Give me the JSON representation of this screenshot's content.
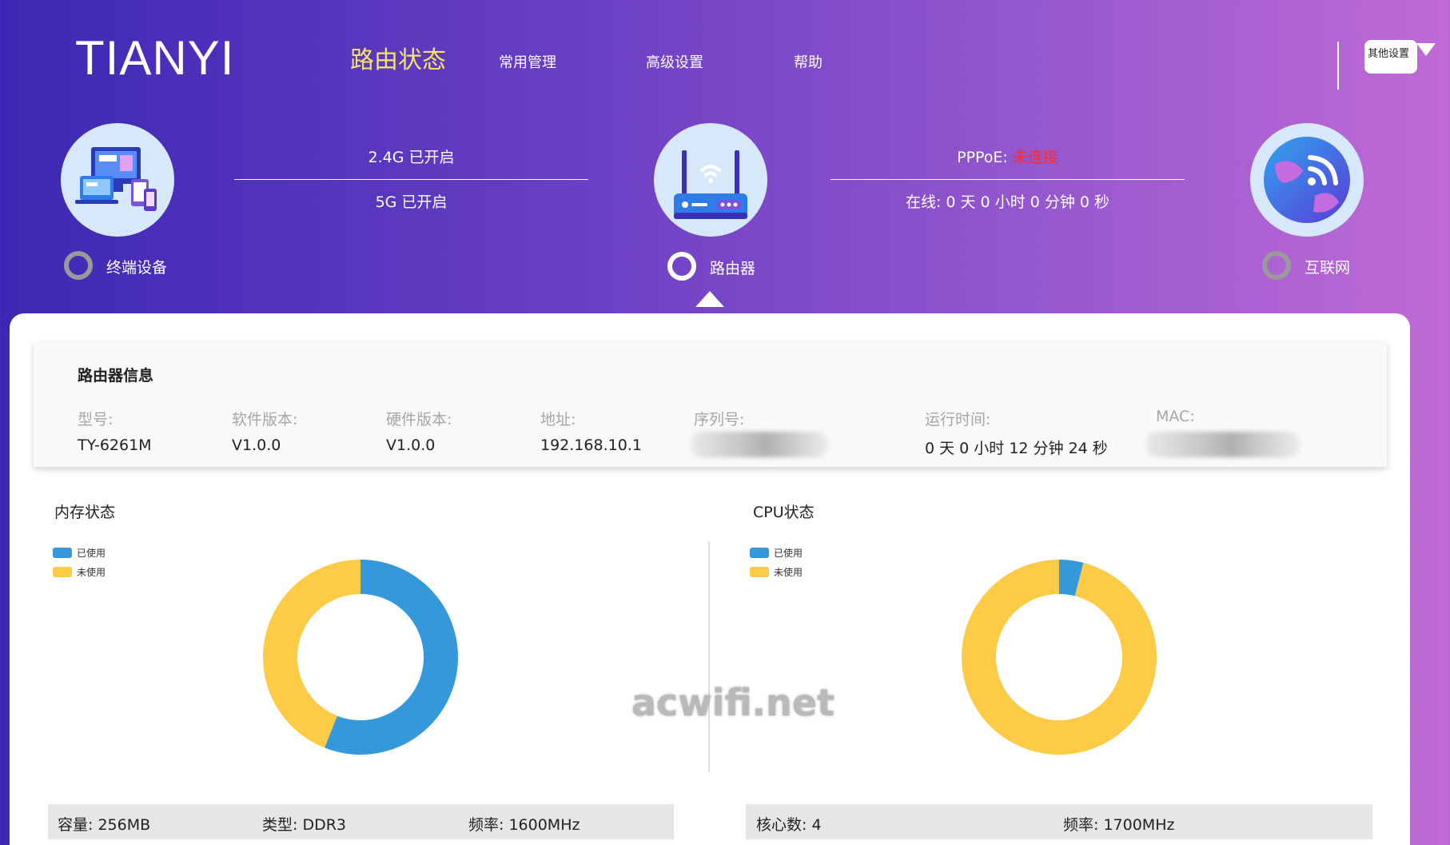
{
  "header": {
    "logo": "TIANYI",
    "nav": [
      {
        "label": "路由状态",
        "active": true
      },
      {
        "label": "常用管理",
        "active": false
      },
      {
        "label": "高级设置",
        "active": false
      },
      {
        "label": "帮助",
        "active": false
      }
    ],
    "other_settings": "其他设置"
  },
  "topology": {
    "terminal": {
      "label": "终端设备",
      "icon": "devices-icon",
      "status": "off"
    },
    "router": {
      "label": "路由器",
      "icon": "router-icon",
      "status": "on"
    },
    "internet": {
      "label": "互联网",
      "icon": "globe-icon",
      "status": "off"
    },
    "wifi": {
      "band_24": "2.4G 已开启",
      "band_5": "5G 已开启"
    },
    "wan": {
      "pppoe_prefix": "PPPoE: ",
      "pppoe_status": "未连接",
      "online_time": "在线: 0 天 0 小时 0 分钟 0 秒"
    }
  },
  "router_info": {
    "title": "路由器信息",
    "fields": [
      {
        "label": "型号:",
        "value": "TY-6261M"
      },
      {
        "label": "软件版本:",
        "value": "V1.0.0"
      },
      {
        "label": "硬件版本:",
        "value": "V1.0.0"
      },
      {
        "label": "地址:",
        "value": "192.168.10.1"
      },
      {
        "label": "序列号:",
        "value": ""
      },
      {
        "label": "运行时间:",
        "value": "0 天 0 小时 12 分钟 24 秒"
      },
      {
        "label": "MAC:",
        "value": ""
      }
    ]
  },
  "memory": {
    "title": "内存状态",
    "legend": {
      "used": "已使用",
      "free": "未使用"
    },
    "used_fraction": 0.56,
    "capacity": "容量: 256MB",
    "type": "类型: DDR3",
    "frequency": "频率: 1600MHz"
  },
  "cpu": {
    "title": "CPU状态",
    "legend": {
      "used": "已使用",
      "free": "未使用"
    },
    "used_fraction": 0.04,
    "cores": "核心数: 4",
    "frequency": "频率: 1700MHz"
  },
  "colors": {
    "used": "#3498db",
    "free": "#fecb47",
    "active_nav": "#f5e46a",
    "alert": "#ff2a2a"
  },
  "watermark": "acwifi.net"
}
